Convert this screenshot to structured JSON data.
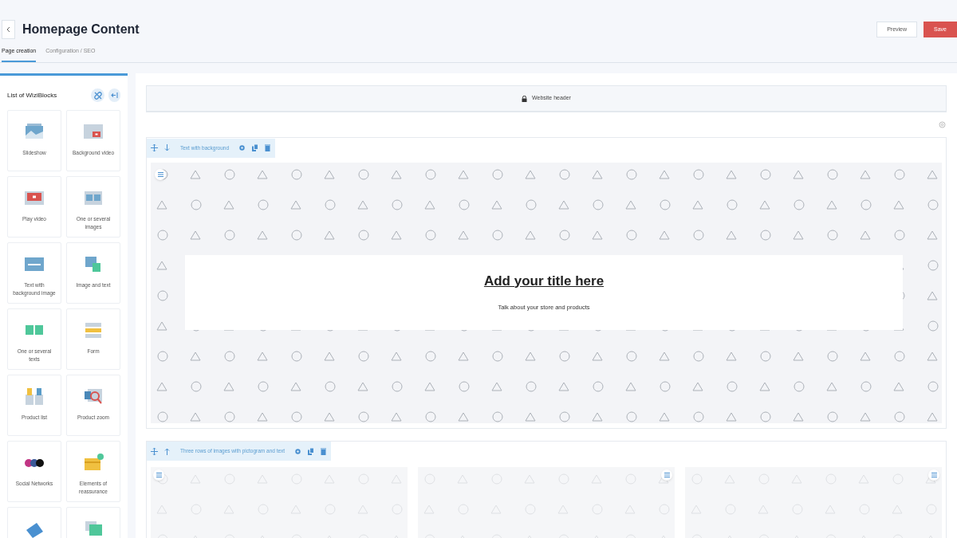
{
  "page": {
    "title": "Homepage Content"
  },
  "actions": [
    {
      "label": "Preview",
      "kind": "secondary"
    },
    {
      "label": "Save",
      "kind": "primary"
    }
  ],
  "tabs": [
    {
      "label": "Page creation",
      "selected": true
    },
    {
      "label": "Configuration / SEO",
      "selected": false
    }
  ],
  "sidebar": {
    "title": "List of WiziBlocks",
    "blocks": [
      {
        "label": "Slideshow"
      },
      {
        "label": "Background video"
      },
      {
        "label": "Play video"
      },
      {
        "label": "One or several images"
      },
      {
        "label": "Text with background image"
      },
      {
        "label": "Image and text"
      },
      {
        "label": "One or several texts"
      },
      {
        "label": "Form"
      },
      {
        "label": "Product list"
      },
      {
        "label": "Product zoom"
      },
      {
        "label": "Social Networks"
      },
      {
        "label": "Elements of reassurance"
      }
    ]
  },
  "canvas": {
    "header_label": "Website header",
    "sections": [
      {
        "name": "Text with background",
        "kind": "banner",
        "title": "Add your title here",
        "subtitle": "Talk about your store and products"
      },
      {
        "name": "Three rows of images with pictogram and text",
        "kind": "columns"
      }
    ]
  }
}
